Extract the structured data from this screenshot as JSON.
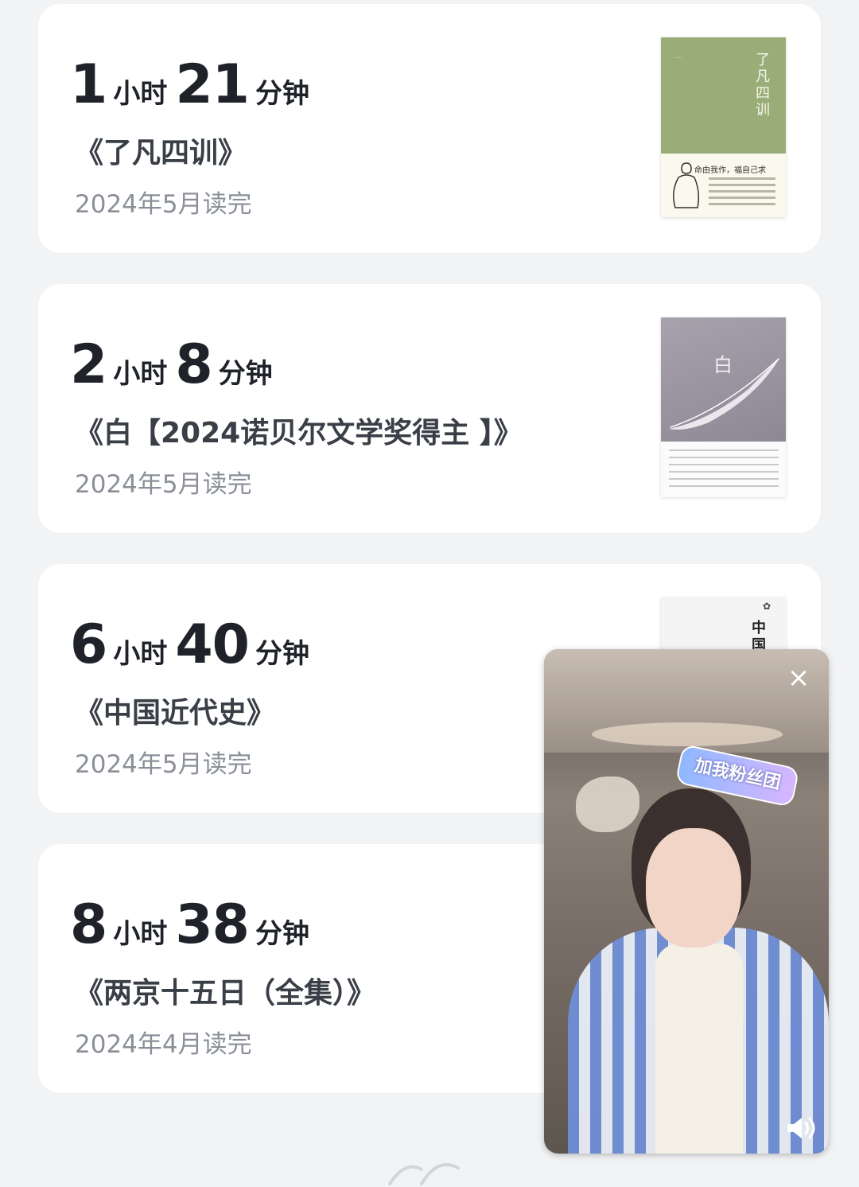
{
  "labels": {
    "hours_unit": "小时",
    "minutes_unit": "分钟"
  },
  "books": [
    {
      "hours": "1",
      "minutes": "21",
      "title": "《了凡四训》",
      "date": "2024年5月读完",
      "cover": {
        "vertical_title": "了凡四训",
        "slogan": "命由我作，福自己求"
      }
    },
    {
      "hours": "2",
      "minutes": "8",
      "title": "《白【2024诺贝尔文学奖得主 】》",
      "date": "2024年5月读完",
      "cover": {
        "vertical_title": "白"
      }
    },
    {
      "hours": "6",
      "minutes": "40",
      "title": "《中国近代史》",
      "date": "2024年5月读完",
      "cover": {
        "vertical_title": "中国"
      }
    },
    {
      "hours": "8",
      "minutes": "38",
      "title": "《两京十五日（全集）》",
      "date": "2024年4月读完"
    }
  ],
  "video_overlay": {
    "badge_text": "加我粉丝团",
    "close_icon": "×",
    "sound_icon": "volume-icon"
  }
}
